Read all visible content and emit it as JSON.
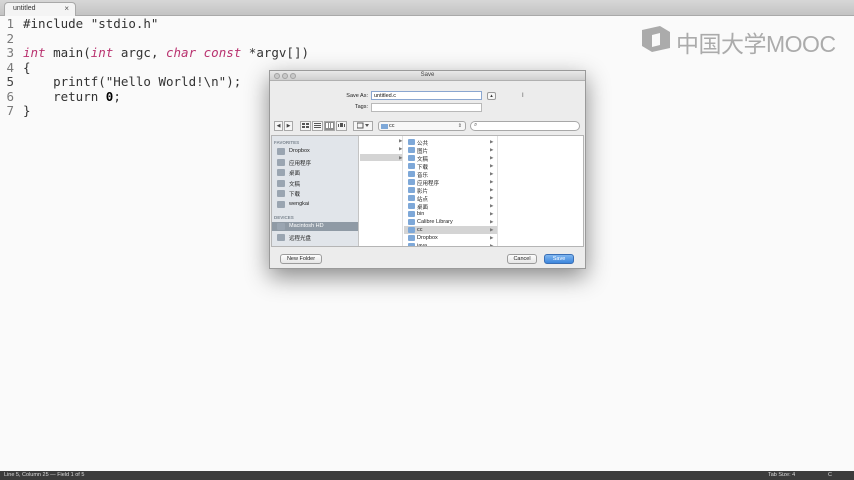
{
  "editor": {
    "tab_title": "untitled",
    "tab_close": "×",
    "line_numbers": [
      "1",
      "2",
      "3",
      "4",
      "5",
      "6",
      "7"
    ],
    "code": {
      "line1": "#include \"stdio.h\"",
      "line3_kw1": "int",
      "line3_a": " main(",
      "line3_kw2": "int",
      "line3_b": " argc, ",
      "line3_kw3": "char",
      "line3_c": " ",
      "line3_kw4": "const",
      "line3_d": " *argv[])",
      "line4": "{",
      "line5": "    printf(\"Hello World!\\n\");",
      "line6_a": "    return ",
      "line6_num": "0",
      "line6_b": ";",
      "line7": "}"
    }
  },
  "watermark": {
    "text": "中国大学MOOC"
  },
  "statusbar": {
    "position": "Line 5, Column 25 — Field 1 of 5",
    "tab_size": "Tab Size: 4",
    "syntax": "C"
  },
  "dialog": {
    "title": "Save",
    "save_as_label": "Save As:",
    "save_as_value": "untitled.c",
    "tags_label": "Tags:",
    "tags_value": "",
    "expand_glyph": "▴",
    "toolbar": {
      "back": "◀",
      "forward": "▶",
      "location": "cc"
    },
    "sidebar": {
      "favorites_heading": "FAVORITES",
      "favorites": [
        "Dropbox",
        "应用程序",
        "桌面",
        "文稿",
        "下载",
        "wengkai"
      ],
      "devices_heading": "DEVICES",
      "devices": [
        "Macintosh HD",
        "远程光盘"
      ],
      "selected_device": "Macintosh HD"
    },
    "folders": [
      "公共",
      "图片",
      "文稿",
      "下载",
      "音乐",
      "应用程序",
      "影片",
      "站点",
      "桌面",
      "bin",
      "Calibre Library",
      "cc",
      "Dropbox",
      "java"
    ],
    "selected_folder": "cc",
    "buttons": {
      "new_folder": "New Folder",
      "cancel": "Cancel",
      "save": "Save"
    }
  }
}
